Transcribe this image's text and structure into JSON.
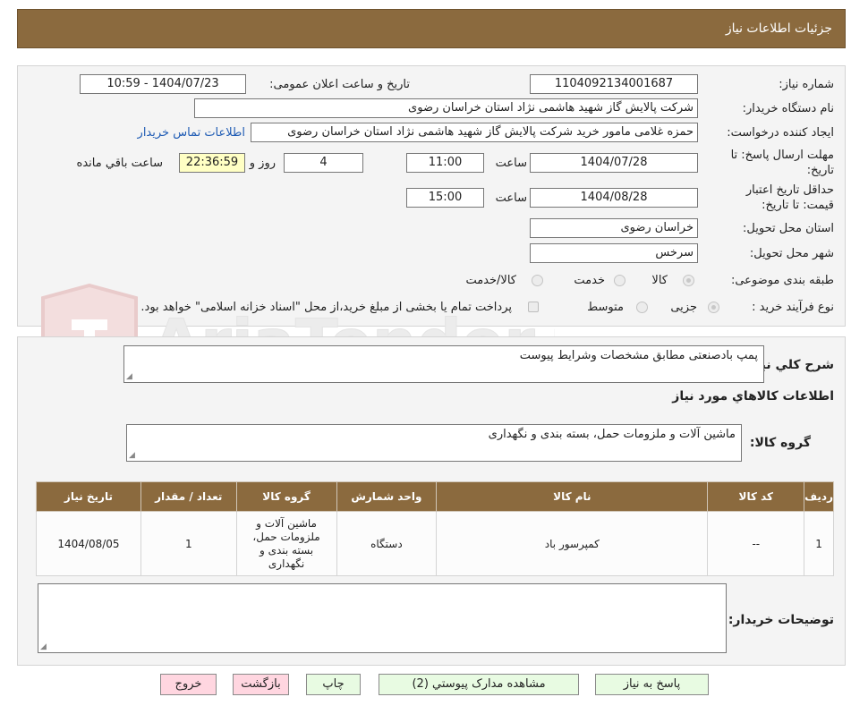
{
  "header": {
    "title": "جزئیات اطلاعات نیاز"
  },
  "watermark": {
    "brand": "AriaTender.neT"
  },
  "form": {
    "need_number": {
      "label": "شماره نیاز:",
      "value": "1104092134001687"
    },
    "announce": {
      "label": "تاریخ و ساعت اعلان عمومی:",
      "value": "1404/07/23 - 10:59"
    },
    "buyer_org": {
      "label": "نام دستگاه خریدار:",
      "value": "شرکت پالایش گاز شهید هاشمی نژاد   استان خراسان رضوی"
    },
    "requester": {
      "label": "ایجاد کننده درخواست:",
      "value": "حمزه غلامی مامور خرید شرکت پالایش گاز شهید هاشمی نژاد   استان خراسان رضوی",
      "contact_link": "اطلاعات تماس خریدار"
    },
    "deadline": {
      "label1": "مهلت ارسال پاسخ: تا",
      "label2": "تاریخ:",
      "date": "1404/07/28",
      "time_label": "ساعت",
      "time": "11:00",
      "days": "4",
      "days_label": "روز و",
      "remaining": "22:36:59",
      "remaining_label": "ساعت باقي مانده"
    },
    "validity": {
      "label1": "حداقل تاريخ اعتبار",
      "label2": "قیمت: تا تاریخ:",
      "date": "1404/08/28",
      "time_label": "ساعت",
      "time": "15:00"
    },
    "province": {
      "label": "استان محل تحویل:",
      "value": "خراسان رضوی"
    },
    "city": {
      "label": "شهر محل تحویل:",
      "value": "سرخس"
    },
    "category": {
      "label": "طبقه بندی موضوعی:",
      "options": [
        "کالا",
        "خدمت",
        "کالا/خدمت"
      ],
      "selected": "کالا"
    },
    "process": {
      "label": "نوع فرآیند خرید :",
      "options": [
        "جزیی",
        "متوسط"
      ],
      "selected": "جزیی",
      "checkbox_text": "پرداخت تمام یا بخشی از مبلغ خرید،از محل \"اسناد خزانه اسلامی\" خواهد بود."
    }
  },
  "general": {
    "label": "شرح کلي نياز:",
    "value": "پمپ بادصنعتی مطابق مشخصات وشرایط پیوست"
  },
  "goods_info": {
    "title": "اطلاعات کالاهاي مورد نياز"
  },
  "goods_group": {
    "label": "گروه کالا:",
    "value": "ماشین آلات و ملزومات حمل، بسته بندی و نگهداری"
  },
  "table": {
    "headers": [
      "ردیف",
      "کد کالا",
      "نام کالا",
      "واحد شمارش",
      "گروه کالا",
      "تعداد / مقدار",
      "تاریخ نیاز"
    ],
    "rows": [
      {
        "row": "1",
        "code": "--",
        "name": "کمپرسور باد",
        "unit": "دستگاه",
        "group": "ماشین آلات و ملزومات حمل، بسته بندی و نگهداری",
        "qty": "1",
        "date": "1404/08/05"
      }
    ]
  },
  "buyer_notes": {
    "label": "توضیحات خریدار:",
    "value": ""
  },
  "buttons": {
    "reply": "پاسخ به نیاز",
    "attachments": "مشاهده مدارک پیوستي (2)",
    "print": "چاپ",
    "back": "بازگشت",
    "exit": "خروج"
  },
  "colors": {
    "header_bg": "#8b6a3e",
    "link": "#1e5bb4",
    "button_bg": "#e8fbe2",
    "button_pink": "#ffd6e0",
    "remaining_bg": "#ffffc4"
  }
}
